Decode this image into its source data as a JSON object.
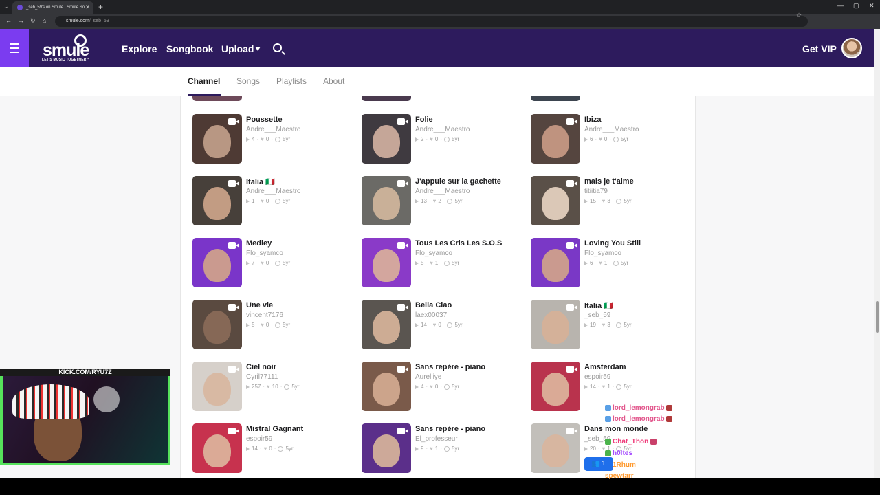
{
  "browser": {
    "tab_title": "_seb_59's on Smule | Smule So...",
    "url_domain": "smule.com",
    "url_path": "/_seb_59"
  },
  "header": {
    "logo_text": "smule",
    "logo_tagline": "LET'S MUSIC TOGETHER™",
    "nav": [
      "Explore",
      "Songbook",
      "Upload"
    ],
    "get_vip": "Get VIP"
  },
  "tabs": [
    "Channel",
    "Songs",
    "Playlists",
    "About"
  ],
  "active_tab": "Channel",
  "songs": [
    {
      "title": "Poussette",
      "user": "Andre___Maestro",
      "plays": "4",
      "likes": "0",
      "age": "5yr"
    },
    {
      "title": "Folie",
      "user": "Andre___Maestro",
      "plays": "2",
      "likes": "0",
      "age": "5yr"
    },
    {
      "title": "Ibiza",
      "user": "Andre___Maestro",
      "plays": "6",
      "likes": "0",
      "age": "5yr"
    },
    {
      "title": "Italia 🇮🇹",
      "user": "Andre___Maestro",
      "plays": "1",
      "likes": "0",
      "age": "5yr"
    },
    {
      "title": "J'appuie sur la gachette",
      "user": "Andre___Maestro",
      "plays": "13",
      "likes": "2",
      "age": "5yr"
    },
    {
      "title": "mais je t'aime",
      "user": "titiitia79",
      "plays": "15",
      "likes": "3",
      "age": "5yr"
    },
    {
      "title": "Medley",
      "user": "Flo_syamco",
      "plays": "7",
      "likes": "0",
      "age": "5yr"
    },
    {
      "title": "Tous Les Cris Les S.O.S",
      "user": "Flo_syamco",
      "plays": "5",
      "likes": "1",
      "age": "5yr"
    },
    {
      "title": "Loving You Still",
      "user": "Flo_syamco",
      "plays": "6",
      "likes": "1",
      "age": "5yr"
    },
    {
      "title": "Une vie",
      "user": "vincent7176",
      "plays": "5",
      "likes": "0",
      "age": "5yr"
    },
    {
      "title": "Bella Ciao",
      "user": "laex00037",
      "plays": "14",
      "likes": "0",
      "age": "5yr"
    },
    {
      "title": "Italia 🇮🇹",
      "user": "_seb_59",
      "plays": "19",
      "likes": "3",
      "age": "5yr"
    },
    {
      "title": "Ciel noir",
      "user": "Cyril77111",
      "plays": "257",
      "likes": "10",
      "age": "5yr"
    },
    {
      "title": "Sans repère - piano",
      "user": "Aureliiye",
      "plays": "4",
      "likes": "0",
      "age": "5yr"
    },
    {
      "title": "Amsterdam",
      "user": "espoir59",
      "plays": "14",
      "likes": "1",
      "age": "5yr"
    },
    {
      "title": "Mistral Gagnant",
      "user": "espoir59",
      "plays": "14",
      "likes": "0",
      "age": "5yr"
    },
    {
      "title": "Sans repère - piano",
      "user": "El_professeur",
      "plays": "9",
      "likes": "1",
      "age": "5yr"
    },
    {
      "title": "Dans mon monde",
      "user": "_seb_59",
      "plays": "20",
      "likes": "1",
      "age": "5yr"
    }
  ],
  "overlay": {
    "webcam_label": "KICK.COM/RYU7Z",
    "chat": [
      {
        "name": "lord_lemongrab",
        "color": "#e2568c"
      },
      {
        "name": "lord_lemongrab",
        "color": "#e2568c"
      },
      {
        "name": "Chat_Thon",
        "color": "#ef3b7a"
      },
      {
        "name": "h0ltes",
        "color": "#a64dff"
      },
      {
        "name": "1Rhum",
        "color": "#ff9a2f"
      },
      {
        "name": "spewtarr",
        "color": "#ff9a2f"
      }
    ],
    "viewer_count": "1"
  },
  "colors": {
    "header_bg": "#2d1b5d",
    "menu_accent": "#7b3cf0",
    "webcam_border": "#56e25b"
  }
}
